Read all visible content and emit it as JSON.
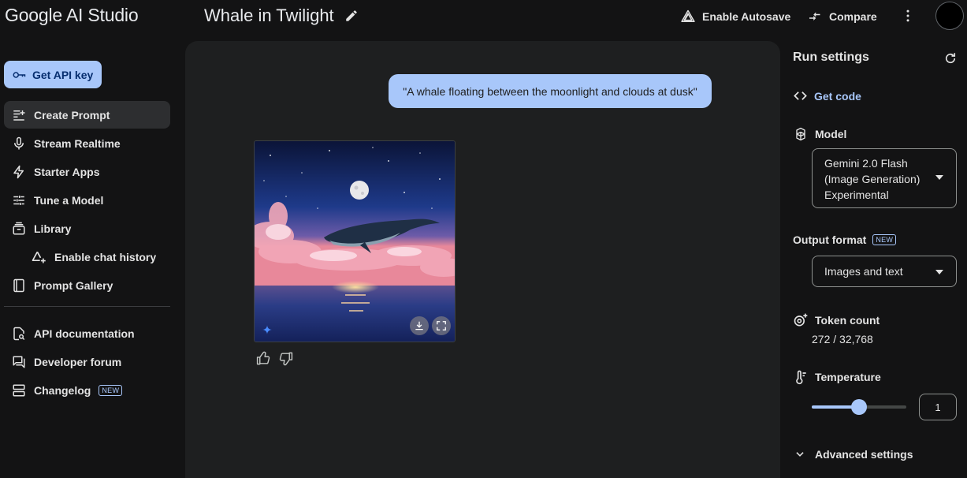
{
  "app": {
    "title": "Google AI Studio"
  },
  "document": {
    "title": "Whale in Twilight"
  },
  "topbar": {
    "autosave_label": "Enable Autosave",
    "compare_label": "Compare"
  },
  "sidebar": {
    "api_key_label": "Get API key",
    "items": [
      {
        "label": "Create Prompt",
        "icon": "create-prompt-icon",
        "active": true
      },
      {
        "label": "Stream Realtime",
        "icon": "microphone-icon"
      },
      {
        "label": "Starter Apps",
        "icon": "bolt-icon"
      },
      {
        "label": "Tune a Model",
        "icon": "tune-icon"
      },
      {
        "label": "Library",
        "icon": "library-icon"
      },
      {
        "label": "Enable chat history",
        "icon": "drive-icon",
        "sub": true
      },
      {
        "label": "Prompt Gallery",
        "icon": "gallery-icon"
      }
    ],
    "resources": [
      {
        "label": "API documentation",
        "icon": "docs-icon"
      },
      {
        "label": "Developer forum",
        "icon": "forum-icon"
      },
      {
        "label": "Changelog",
        "icon": "changelog-icon",
        "badge": "NEW"
      }
    ]
  },
  "chat": {
    "user_prompt": "\"A whale floating between the moonlight and clouds at dusk\""
  },
  "run_settings": {
    "title": "Run settings",
    "get_code_label": "Get code",
    "model_label": "Model",
    "model_lines": [
      "Gemini 2.0 Flash",
      "(Image Generation)",
      "Experimental"
    ],
    "output_format_label": "Output format",
    "output_format_badge": "NEW",
    "output_format_value": "Images and text",
    "token_count_label": "Token count",
    "token_count_value": "272 / 32,768",
    "temperature_label": "Temperature",
    "temperature_value": "1",
    "temperature_fraction": 0.5,
    "advanced_label": "Advanced settings"
  },
  "colors": {
    "accent": "#a8c7fa",
    "background": "#131314",
    "panel": "#1e1f20"
  }
}
